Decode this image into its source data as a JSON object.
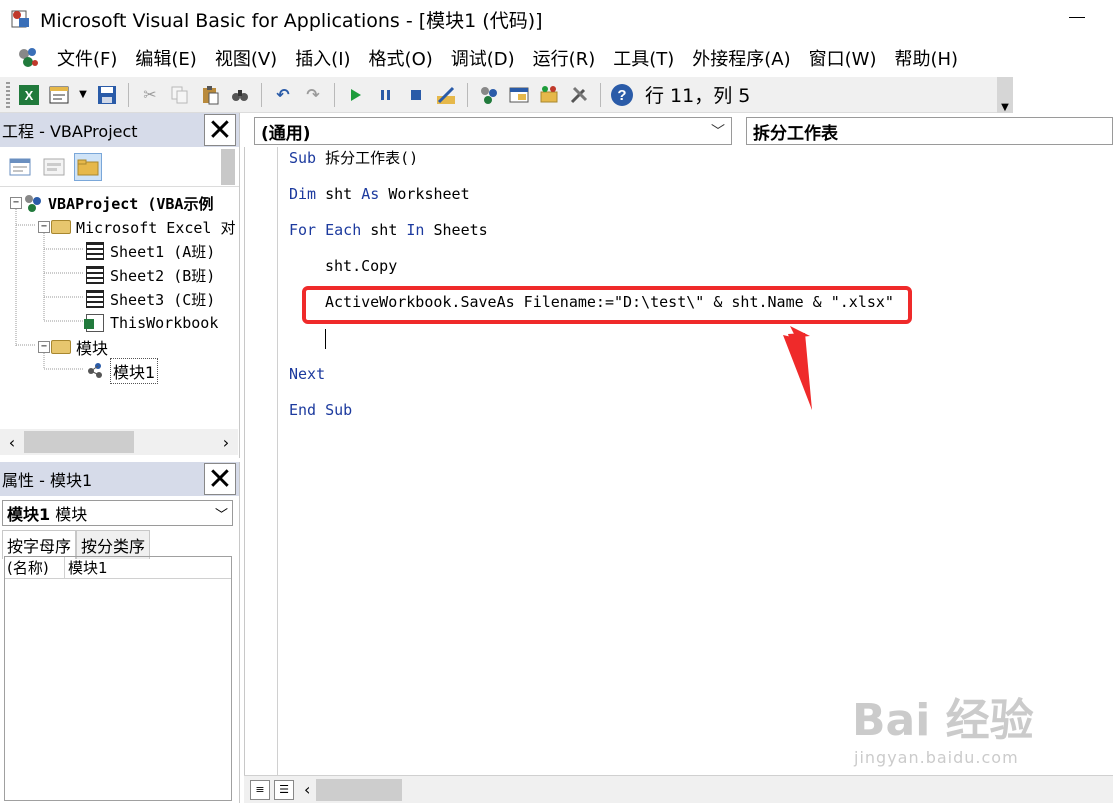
{
  "window": {
    "title": "Microsoft Visual Basic for Applications - [模块1 (代码)]"
  },
  "menubar": {
    "items": [
      "文件(F)",
      "编辑(E)",
      "视图(V)",
      "插入(I)",
      "格式(O)",
      "调试(D)",
      "运行(R)",
      "工具(T)",
      "外接程序(A)",
      "窗口(W)",
      "帮助(H)"
    ]
  },
  "toolbar": {
    "position_text": "行 11，列 5"
  },
  "project_pane": {
    "title": "工程 - VBAProject",
    "tree": {
      "root": "VBAProject (VBA示例",
      "excel_objects": "Microsoft Excel 对",
      "sheets": [
        "Sheet1 (A班)",
        "Sheet2 (B班)",
        "Sheet3 (C班)"
      ],
      "workbook": "ThisWorkbook",
      "modules_folder": "模块",
      "module": "模块1"
    }
  },
  "properties_pane": {
    "title": "属性 - 模块1",
    "object_name": "模块1",
    "object_type": "模块",
    "tabs": [
      "按字母序",
      "按分类序"
    ],
    "rows": [
      {
        "key": "(名称)",
        "value": "模块1"
      }
    ]
  },
  "code_window": {
    "object_combo": "(通用)",
    "procedure_combo": "拆分工作表",
    "lines": {
      "l1_kw": "Sub",
      "l1_rest": " 拆分工作表()",
      "l2_kw": "Dim",
      "l2_mid": " sht ",
      "l2_kw2": "As",
      "l2_rest": " Worksheet",
      "l3_kw": "For Each",
      "l3_mid": " sht ",
      "l3_kw2": "In",
      "l3_rest": " Sheets",
      "l4": "sht.Copy",
      "l5": "ActiveWorkbook.SaveAs Filename:=\"D:\\test\\\" & sht.Name & \".xlsx\"",
      "l7_kw": "Next",
      "l8_kw": "End Sub"
    }
  },
  "watermark": {
    "main": "Bai 经验",
    "sub": "jingyan.baidu.com"
  },
  "colors": {
    "keyword": "#1c3a9e",
    "annotation": "#ef2a2a",
    "pane_header": "#d6dbe9"
  }
}
